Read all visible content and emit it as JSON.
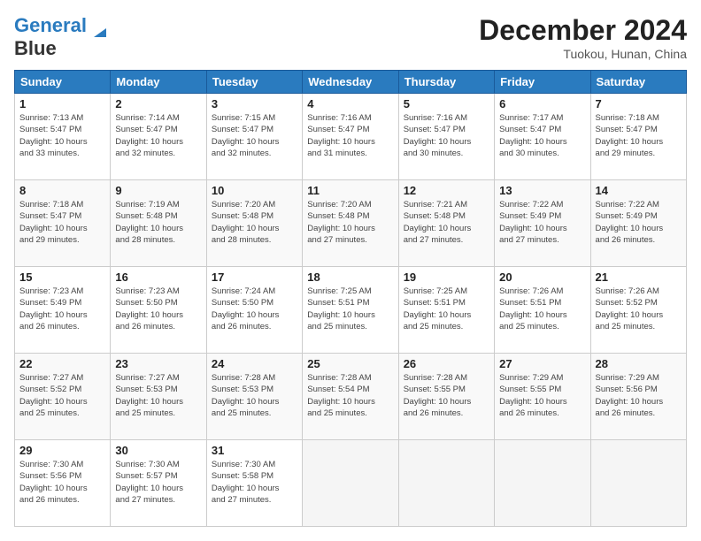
{
  "logo": {
    "text1": "General",
    "text2": "Blue"
  },
  "title": "December 2024",
  "location": "Tuokou, Hunan, China",
  "headers": [
    "Sunday",
    "Monday",
    "Tuesday",
    "Wednesday",
    "Thursday",
    "Friday",
    "Saturday"
  ],
  "weeks": [
    [
      {
        "day": "1",
        "info": "Sunrise: 7:13 AM\nSunset: 5:47 PM\nDaylight: 10 hours\nand 33 minutes."
      },
      {
        "day": "2",
        "info": "Sunrise: 7:14 AM\nSunset: 5:47 PM\nDaylight: 10 hours\nand 32 minutes."
      },
      {
        "day": "3",
        "info": "Sunrise: 7:15 AM\nSunset: 5:47 PM\nDaylight: 10 hours\nand 32 minutes."
      },
      {
        "day": "4",
        "info": "Sunrise: 7:16 AM\nSunset: 5:47 PM\nDaylight: 10 hours\nand 31 minutes."
      },
      {
        "day": "5",
        "info": "Sunrise: 7:16 AM\nSunset: 5:47 PM\nDaylight: 10 hours\nand 30 minutes."
      },
      {
        "day": "6",
        "info": "Sunrise: 7:17 AM\nSunset: 5:47 PM\nDaylight: 10 hours\nand 30 minutes."
      },
      {
        "day": "7",
        "info": "Sunrise: 7:18 AM\nSunset: 5:47 PM\nDaylight: 10 hours\nand 29 minutes."
      }
    ],
    [
      {
        "day": "8",
        "info": "Sunrise: 7:18 AM\nSunset: 5:47 PM\nDaylight: 10 hours\nand 29 minutes."
      },
      {
        "day": "9",
        "info": "Sunrise: 7:19 AM\nSunset: 5:48 PM\nDaylight: 10 hours\nand 28 minutes."
      },
      {
        "day": "10",
        "info": "Sunrise: 7:20 AM\nSunset: 5:48 PM\nDaylight: 10 hours\nand 28 minutes."
      },
      {
        "day": "11",
        "info": "Sunrise: 7:20 AM\nSunset: 5:48 PM\nDaylight: 10 hours\nand 27 minutes."
      },
      {
        "day": "12",
        "info": "Sunrise: 7:21 AM\nSunset: 5:48 PM\nDaylight: 10 hours\nand 27 minutes."
      },
      {
        "day": "13",
        "info": "Sunrise: 7:22 AM\nSunset: 5:49 PM\nDaylight: 10 hours\nand 27 minutes."
      },
      {
        "day": "14",
        "info": "Sunrise: 7:22 AM\nSunset: 5:49 PM\nDaylight: 10 hours\nand 26 minutes."
      }
    ],
    [
      {
        "day": "15",
        "info": "Sunrise: 7:23 AM\nSunset: 5:49 PM\nDaylight: 10 hours\nand 26 minutes."
      },
      {
        "day": "16",
        "info": "Sunrise: 7:23 AM\nSunset: 5:50 PM\nDaylight: 10 hours\nand 26 minutes."
      },
      {
        "day": "17",
        "info": "Sunrise: 7:24 AM\nSunset: 5:50 PM\nDaylight: 10 hours\nand 26 minutes."
      },
      {
        "day": "18",
        "info": "Sunrise: 7:25 AM\nSunset: 5:51 PM\nDaylight: 10 hours\nand 25 minutes."
      },
      {
        "day": "19",
        "info": "Sunrise: 7:25 AM\nSunset: 5:51 PM\nDaylight: 10 hours\nand 25 minutes."
      },
      {
        "day": "20",
        "info": "Sunrise: 7:26 AM\nSunset: 5:51 PM\nDaylight: 10 hours\nand 25 minutes."
      },
      {
        "day": "21",
        "info": "Sunrise: 7:26 AM\nSunset: 5:52 PM\nDaylight: 10 hours\nand 25 minutes."
      }
    ],
    [
      {
        "day": "22",
        "info": "Sunrise: 7:27 AM\nSunset: 5:52 PM\nDaylight: 10 hours\nand 25 minutes."
      },
      {
        "day": "23",
        "info": "Sunrise: 7:27 AM\nSunset: 5:53 PM\nDaylight: 10 hours\nand 25 minutes."
      },
      {
        "day": "24",
        "info": "Sunrise: 7:28 AM\nSunset: 5:53 PM\nDaylight: 10 hours\nand 25 minutes."
      },
      {
        "day": "25",
        "info": "Sunrise: 7:28 AM\nSunset: 5:54 PM\nDaylight: 10 hours\nand 25 minutes."
      },
      {
        "day": "26",
        "info": "Sunrise: 7:28 AM\nSunset: 5:55 PM\nDaylight: 10 hours\nand 26 minutes."
      },
      {
        "day": "27",
        "info": "Sunrise: 7:29 AM\nSunset: 5:55 PM\nDaylight: 10 hours\nand 26 minutes."
      },
      {
        "day": "28",
        "info": "Sunrise: 7:29 AM\nSunset: 5:56 PM\nDaylight: 10 hours\nand 26 minutes."
      }
    ],
    [
      {
        "day": "29",
        "info": "Sunrise: 7:30 AM\nSunset: 5:56 PM\nDaylight: 10 hours\nand 26 minutes."
      },
      {
        "day": "30",
        "info": "Sunrise: 7:30 AM\nSunset: 5:57 PM\nDaylight: 10 hours\nand 27 minutes."
      },
      {
        "day": "31",
        "info": "Sunrise: 7:30 AM\nSunset: 5:58 PM\nDaylight: 10 hours\nand 27 minutes."
      },
      {
        "day": "",
        "info": ""
      },
      {
        "day": "",
        "info": ""
      },
      {
        "day": "",
        "info": ""
      },
      {
        "day": "",
        "info": ""
      }
    ]
  ]
}
